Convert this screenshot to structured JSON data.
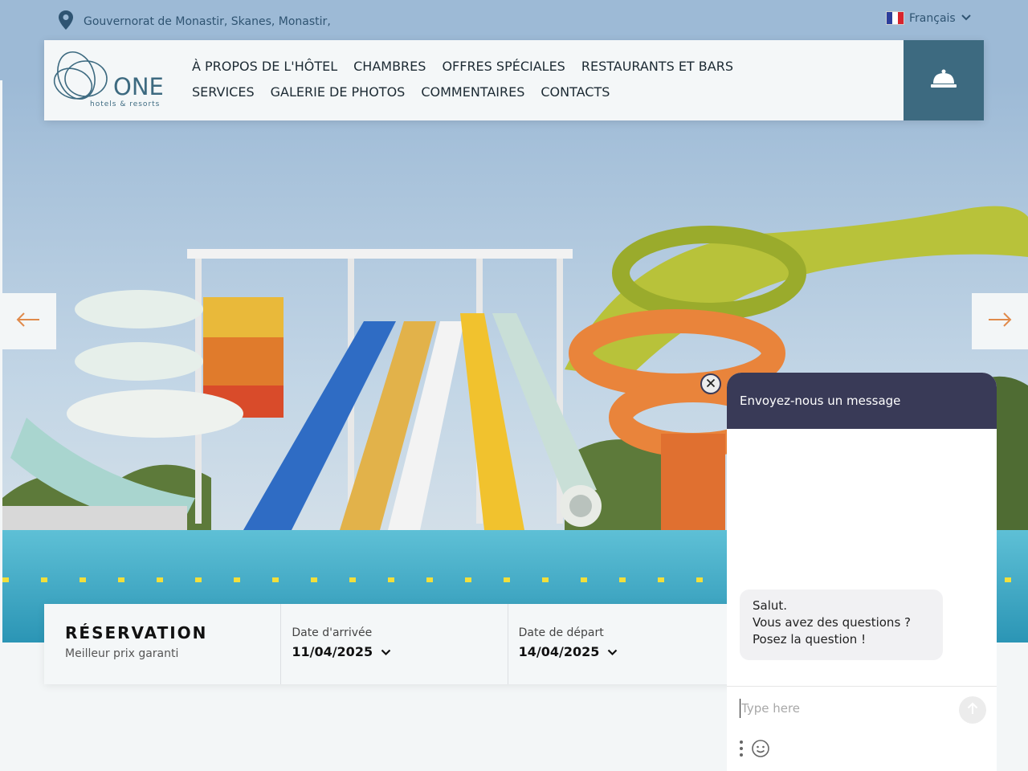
{
  "topbar": {
    "address": "Gouvernorat de Monastir, Skanes, Monastir,",
    "language": "Français"
  },
  "logo": {
    "name": "ONE",
    "tagline": "hotels & resorts"
  },
  "nav": {
    "items": [
      "À PROPOS DE L'HÔTEL",
      "CHAMBRES",
      "OFFRES SPÉCIALES",
      "RESTAURANTS ET BARS",
      "SERVICES",
      "GALERIE DE PHOTOS",
      "COMMENTAIRES",
      "CONTACTS"
    ]
  },
  "reservation": {
    "title": "RÉSERVATION",
    "subtitle": "Meilleur prix garanti",
    "arrival_label": "Date d'arrivée",
    "arrival_value": "11/04/2025",
    "departure_label": "Date de départ",
    "departure_value": "14/04/2025"
  },
  "chat": {
    "header": "Envoyez-nous un message",
    "greeting_lines": [
      "Salut.",
      "Vous avez des questions ?",
      "Posez la question !"
    ],
    "input_placeholder": "Type here"
  },
  "icons": {
    "location": "map-pin-icon",
    "language_chevron": "chevron-down-icon",
    "reception": "reception-bell-icon",
    "prev": "arrow-left-icon",
    "next": "arrow-right-icon",
    "close": "close-icon",
    "send": "send-arrow-icon",
    "more": "more-vertical-icon",
    "emoji": "emoji-icon"
  },
  "colors": {
    "brand_blue": "#3d6a80",
    "chat_header": "#393a57",
    "text_dark": "#1c2a33"
  }
}
